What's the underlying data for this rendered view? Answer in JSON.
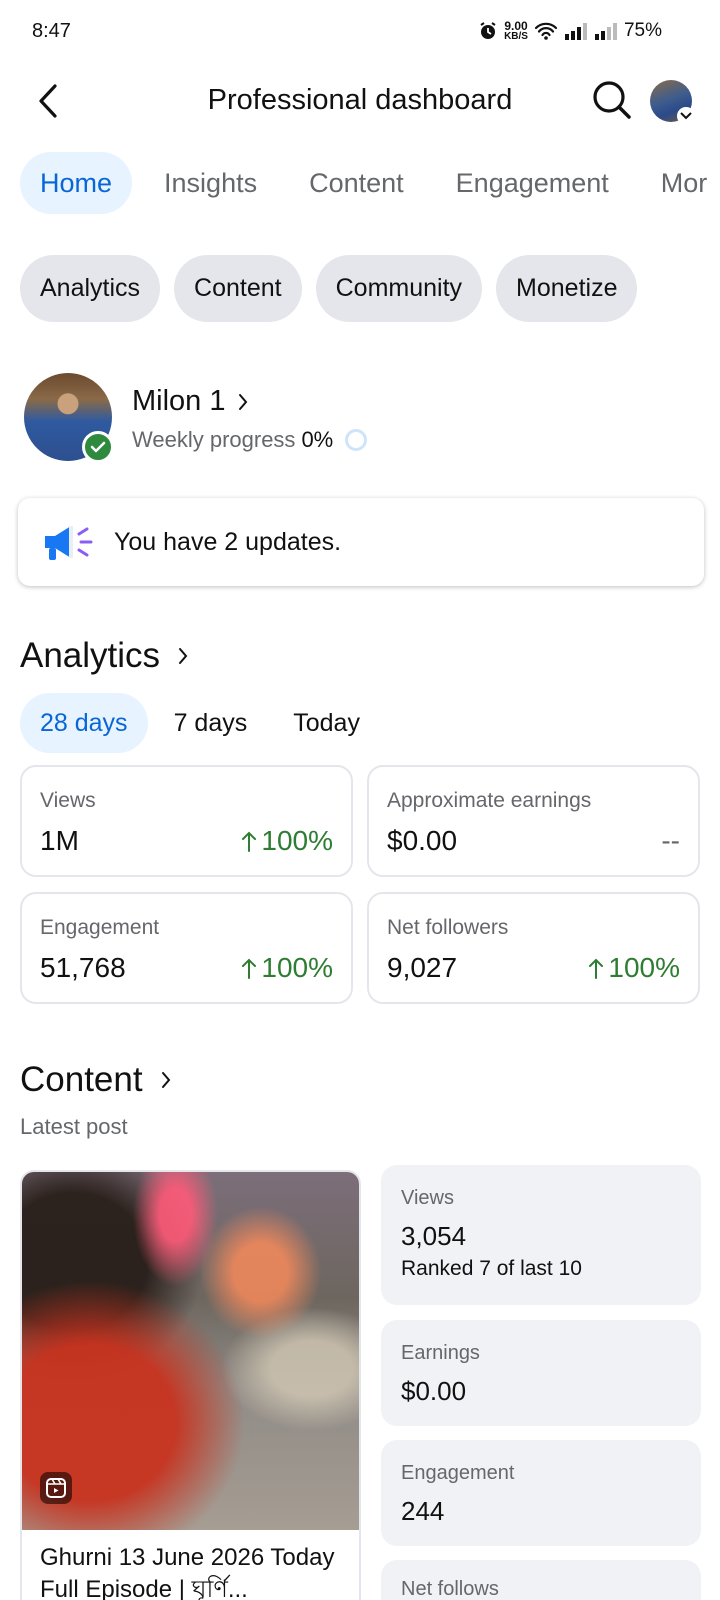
{
  "status_bar": {
    "time": "8:47",
    "net_speed_value": "9.00",
    "net_speed_unit": "KB/S",
    "battery": "75%"
  },
  "header": {
    "title": "Professional dashboard"
  },
  "tabs": [
    {
      "label": "Home",
      "active": true
    },
    {
      "label": "Insights",
      "active": false
    },
    {
      "label": "Content",
      "active": false
    },
    {
      "label": "Engagement",
      "active": false
    },
    {
      "label": "Mor",
      "active": false
    }
  ],
  "chips": [
    {
      "label": "Analytics"
    },
    {
      "label": "Content"
    },
    {
      "label": "Community"
    },
    {
      "label": "Monetize"
    }
  ],
  "profile": {
    "name": "Milon 1",
    "progress_label": "Weekly progress",
    "progress_value": "0%"
  },
  "updates": {
    "text": "You have 2 updates."
  },
  "analytics": {
    "title": "Analytics",
    "ranges": [
      {
        "label": "28 days",
        "active": true
      },
      {
        "label": "7 days",
        "active": false
      },
      {
        "label": "Today",
        "active": false
      }
    ],
    "metrics": [
      {
        "label": "Views",
        "value": "1M",
        "change": "100%",
        "trend": "up"
      },
      {
        "label": "Approximate earnings",
        "value": "$0.00",
        "change": "--",
        "trend": "none"
      },
      {
        "label": "Engagement",
        "value": "51,768",
        "change": "100%",
        "trend": "up"
      },
      {
        "label": "Net followers",
        "value": "9,027",
        "change": "100%",
        "trend": "up"
      }
    ]
  },
  "content": {
    "title": "Content",
    "subtitle": "Latest post",
    "post": {
      "title": "Ghurni 13 June 2026 Today Full Episode | ঘূর্ণি..."
    },
    "stats": [
      {
        "label": "Views",
        "value": "3,054",
        "sub": "Ranked 7 of last 10"
      },
      {
        "label": "Earnings",
        "value": "$0.00"
      },
      {
        "label": "Engagement",
        "value": "244"
      },
      {
        "label": "Net follows"
      }
    ]
  },
  "colors": {
    "accent": "#0866d6",
    "accent_bg": "#e7f3ff",
    "positive": "#2e7d32",
    "chip_bg": "#e4e6eb",
    "verified": "#2e8b3e"
  },
  "icons": [
    "alarm-icon",
    "wifi-icon",
    "signal-icon",
    "back-icon",
    "search-icon",
    "chevron-right-icon",
    "megaphone-icon",
    "arrow-up-icon",
    "reels-icon",
    "verified-icon"
  ]
}
